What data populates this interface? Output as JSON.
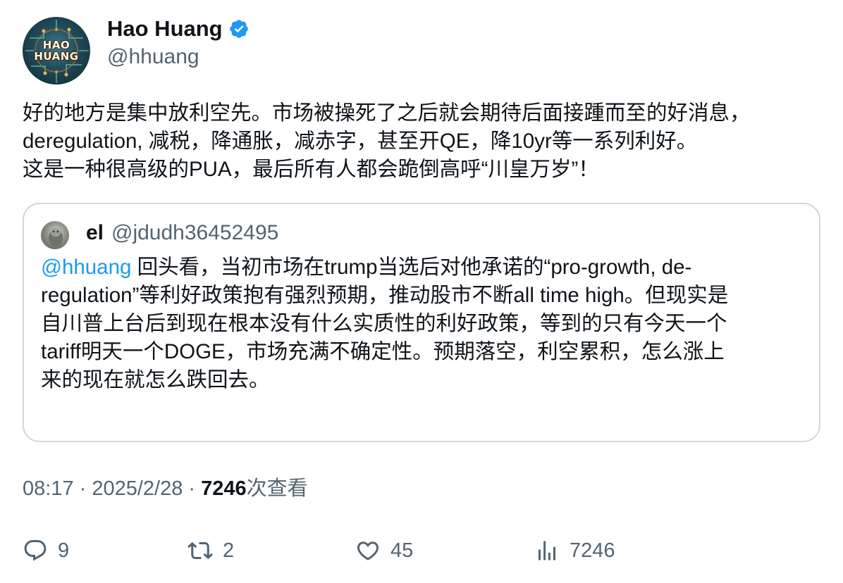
{
  "author": {
    "display_name": "Hao Huang",
    "handle": "@hhuang",
    "verified": true,
    "avatar_text": "HAO\nHUANG"
  },
  "tweet": {
    "text": "好的地方是集中放利空先。市场被操死了之后就会期待后面接踵而至的好消息，\nderegulation, 减税，降通胀，减赤字，甚至开QE，降10yr等一系列利好。\n这是一种很高级的PUA，最后所有人都会跪倒高呼“川皇万岁”！"
  },
  "quote": {
    "name": "el",
    "handle": "@jdudh36452495",
    "mention": "@hhuang",
    "text": " 回头看，当初市场在trump当选后对他承诺的“pro-growth, de-\nregulation”等利好政策抱有强烈预期，推动股市不断all time high。但现实是\n自川普上台后到现在根本没有什么实质性的利好政策，等到的只有今天一个\ntariff明天一个DOGE，市场充满不确定性。预期落空，利空累积，怎么涨上\n来的现在就怎么跌回去。"
  },
  "meta": {
    "time": "08:17",
    "date": "2025/2/28",
    "separator": " · ",
    "views": "7246",
    "views_label": "次查看"
  },
  "actions": {
    "replies": "9",
    "retweets": "2",
    "likes": "45",
    "views": "7246"
  },
  "colors": {
    "accent": "#1d9bf0",
    "secondary_text": "#536471",
    "border": "#cfd9de"
  },
  "icons": [
    "verified-badge-icon",
    "reply-icon",
    "retweet-icon",
    "like-icon",
    "views-icon"
  ]
}
